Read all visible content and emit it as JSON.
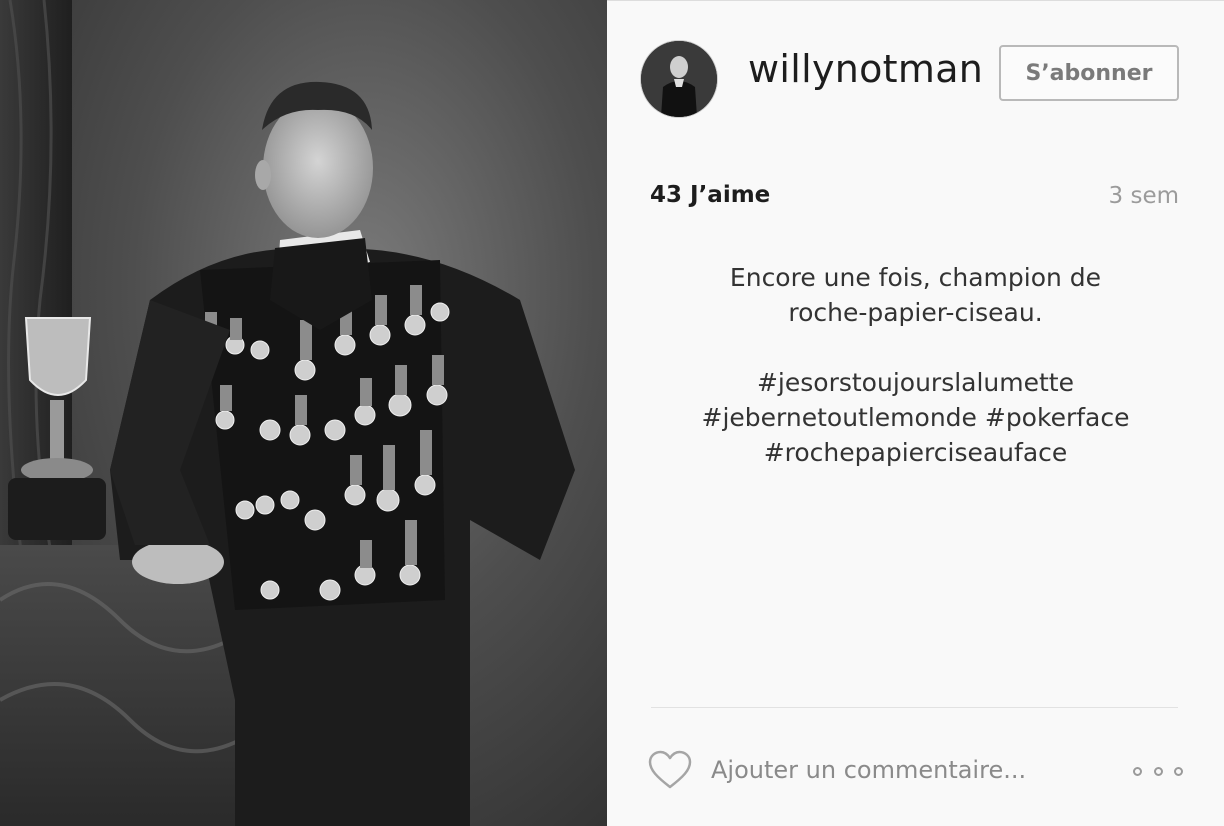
{
  "post": {
    "photo_alt": "Portrait photograph",
    "username": "willynotman",
    "follow_label": "S’abonner",
    "likes": "43 J’aime",
    "time_ago": "3 sem",
    "caption_lines": [
      "Encore une fois, champion de",
      "roche-papier-ciseau."
    ],
    "hashtag_lines": [
      "#jesorstoujourslalumette",
      "#jebernetoutlemonde #pokerface",
      "#rochepapierciseauface"
    ]
  },
  "comment": {
    "placeholder": "Ajouter un commentaire..."
  },
  "icons": {
    "like": "heart-icon",
    "more": "more-options-icon"
  },
  "colors": {
    "panel_bg": "#f9f9f9",
    "button_border": "#b9b9b9",
    "muted_text": "#9b9b9b"
  }
}
